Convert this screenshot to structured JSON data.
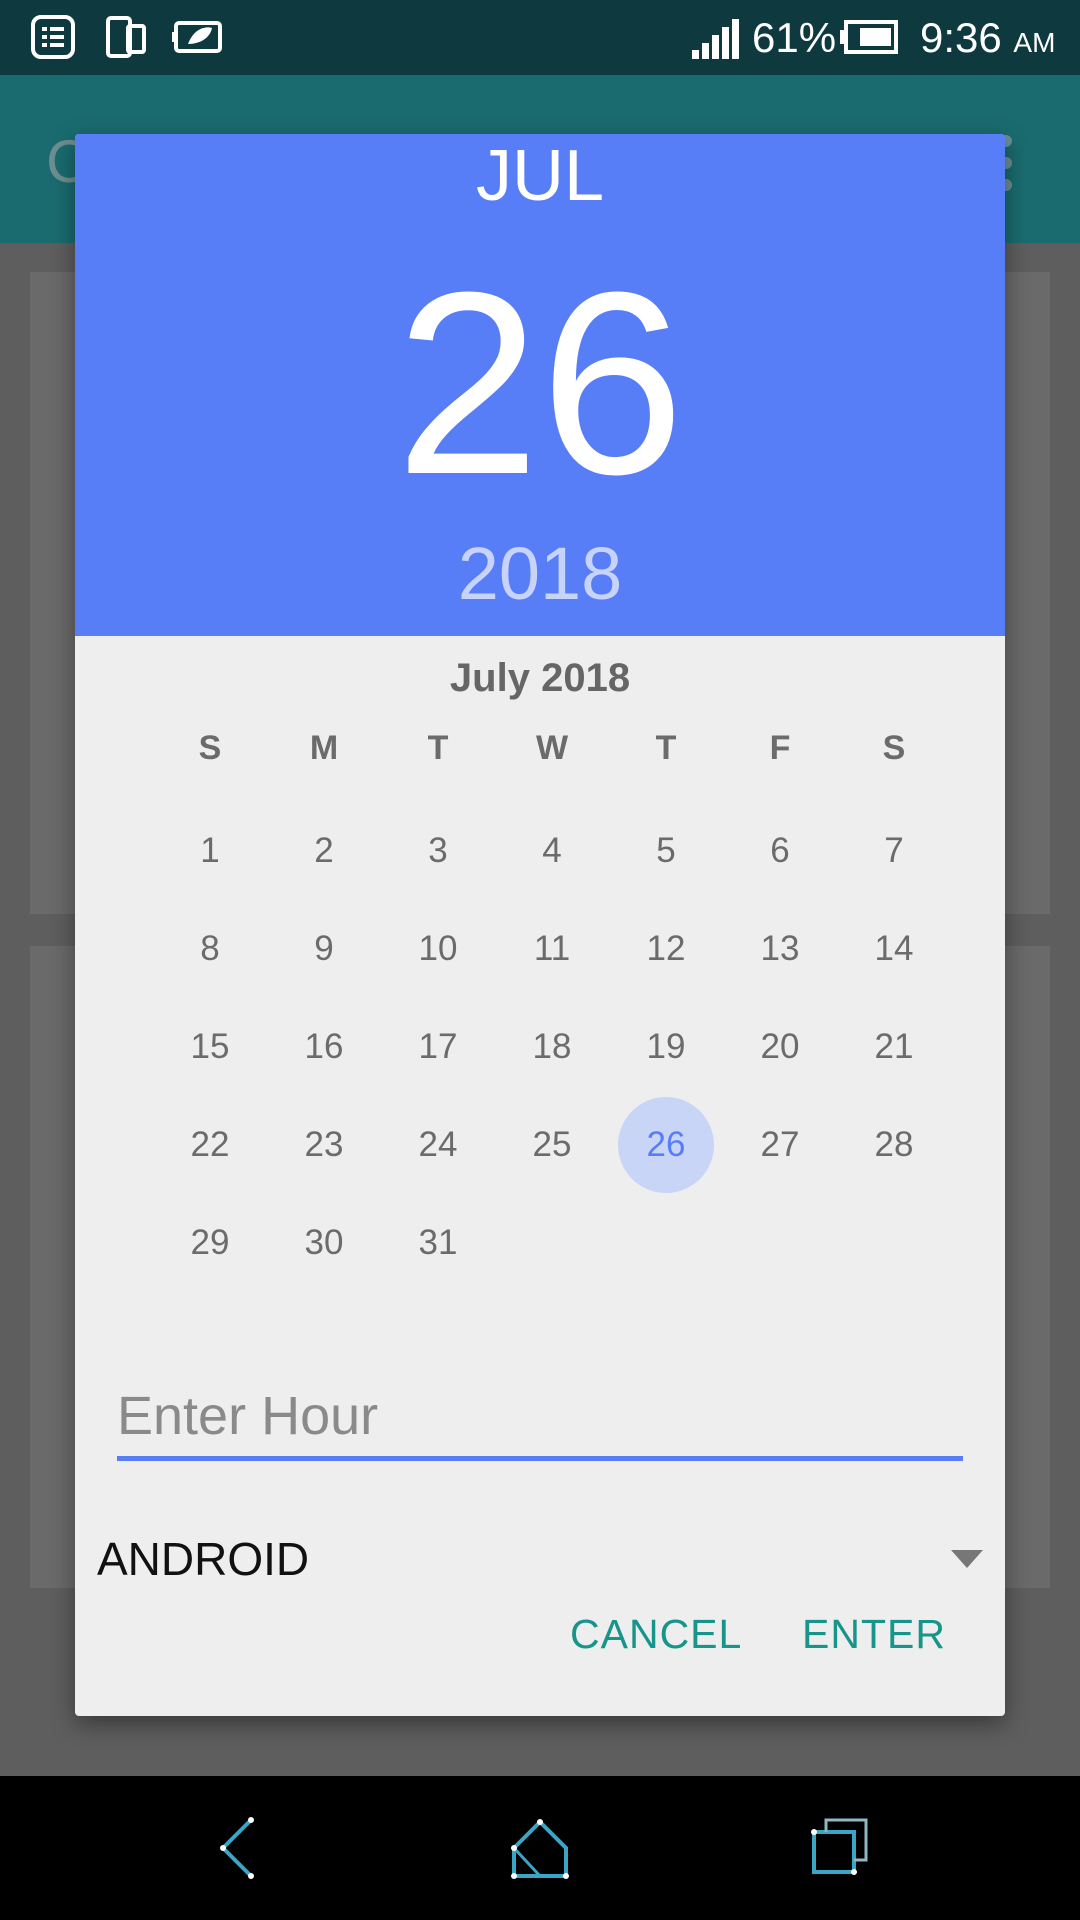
{
  "status_bar": {
    "battery_percent": "61%",
    "time": "9:36",
    "am_pm": "AM",
    "icons": [
      "notes-icon",
      "phone-tablet-icon",
      "leaf-battery-icon",
      "signal-icon",
      "battery-icon"
    ]
  },
  "app_bar": {
    "title_fragment": "C"
  },
  "dialog": {
    "header": {
      "month": "JUL",
      "day": "26",
      "year": "2018"
    },
    "calendar": {
      "month_title": "July 2018",
      "weekdays": [
        "S",
        "M",
        "T",
        "W",
        "T",
        "F",
        "S"
      ],
      "weeks": [
        [
          "1",
          "2",
          "3",
          "4",
          "5",
          "6",
          "7"
        ],
        [
          "8",
          "9",
          "10",
          "11",
          "12",
          "13",
          "14"
        ],
        [
          "15",
          "16",
          "17",
          "18",
          "19",
          "20",
          "21"
        ],
        [
          "22",
          "23",
          "24",
          "25",
          "26",
          "27",
          "28"
        ],
        [
          "29",
          "30",
          "31",
          "",
          "",
          "",
          ""
        ]
      ],
      "selected_day": "26"
    },
    "hour_input": {
      "placeholder": "Enter Hour",
      "value": ""
    },
    "spinner": {
      "selected": "ANDROID"
    },
    "buttons": {
      "cancel": "CANCEL",
      "enter": "ENTER"
    }
  },
  "colors": {
    "accent": "#587ef7",
    "button_text": "#17958a",
    "status_bar": "#0e3a3f",
    "app_bar": "#1a6b6f"
  },
  "nav_bar": {
    "icons": [
      "back-icon",
      "home-icon",
      "recents-icon"
    ]
  }
}
